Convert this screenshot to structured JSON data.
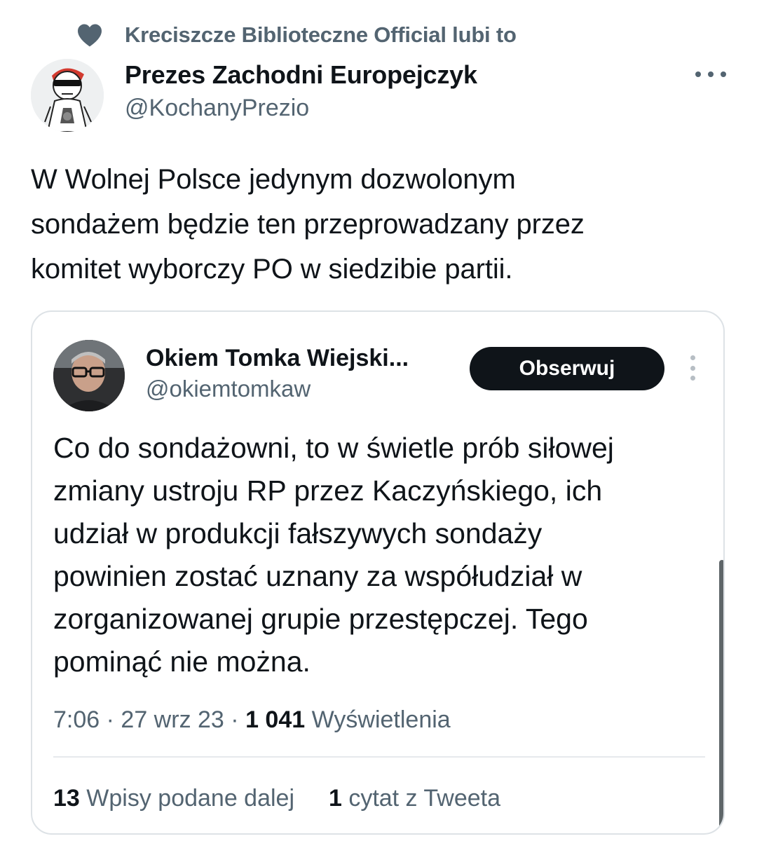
{
  "social_context": {
    "icon": "heart-icon",
    "text": "Kreciszcze Biblioteczne Official lubi to"
  },
  "tweet": {
    "author_name": "Prezes Zachodni Europejczyk",
    "author_handle": "@KochanyPrezio",
    "avatar": "cartoon-avatar-icon",
    "more_icon": "more-horizontal-icon",
    "text_lines": [
      "W Wolnej Polsce jedynym dozwolonym",
      "sondażem będzie ten przeprowadzany przez",
      "komitet wyborczy PO w siedzibie partii."
    ]
  },
  "quoted_tweet": {
    "author_name": "Okiem Tomka Wiejski...",
    "author_handle": "@okiemtomkaw",
    "follow_label": "Obserwuj",
    "more_icon": "more-vertical-icon",
    "text_lines": [
      "Co do sondażowni, to w świetle prób siłowej",
      "zmiany ustroju RP przez Kaczyńskiego, ich",
      "udział w produkcji fałszywych sondaży",
      "powinien zostać uznany za współudział w",
      "zorganizowanej grupie przestępczej. Tego",
      "pominąć nie można."
    ],
    "time": "7:06",
    "separator": "·",
    "date": "27 wrz 23",
    "views_count": "1 041",
    "views_label": "Wyświetlenia",
    "retweets_count": "13",
    "retweets_label": "Wpisy podane dalej",
    "quotes_count": "1",
    "quotes_label": "cytat z Tweeta"
  },
  "colors": {
    "text_primary": "#0f1419",
    "text_secondary": "#536471",
    "border": "#dde2e6",
    "follow_button_bg": "#0f1419"
  }
}
